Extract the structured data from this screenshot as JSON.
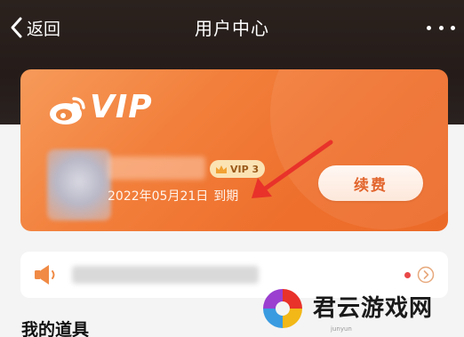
{
  "header": {
    "back_label": "返回",
    "title": "用户中心",
    "more_icon": "more-horizontal-icon"
  },
  "vip_card": {
    "logo_text": "VIP",
    "badge": "VIP 3",
    "expire_date": "2022年05月21日",
    "expire_suffix": "到期",
    "renew_label": "续费",
    "colors": {
      "card": "#f2803c",
      "button_text": "#e05a1e",
      "arrow": "#e8322a"
    }
  },
  "notice": {
    "speaker_icon": "speaker-icon",
    "unread_dot_color": "#e94848"
  },
  "section": {
    "my_items_title": "我的道具"
  },
  "watermark": {
    "name": "君云游戏网",
    "sub": "junyun"
  }
}
